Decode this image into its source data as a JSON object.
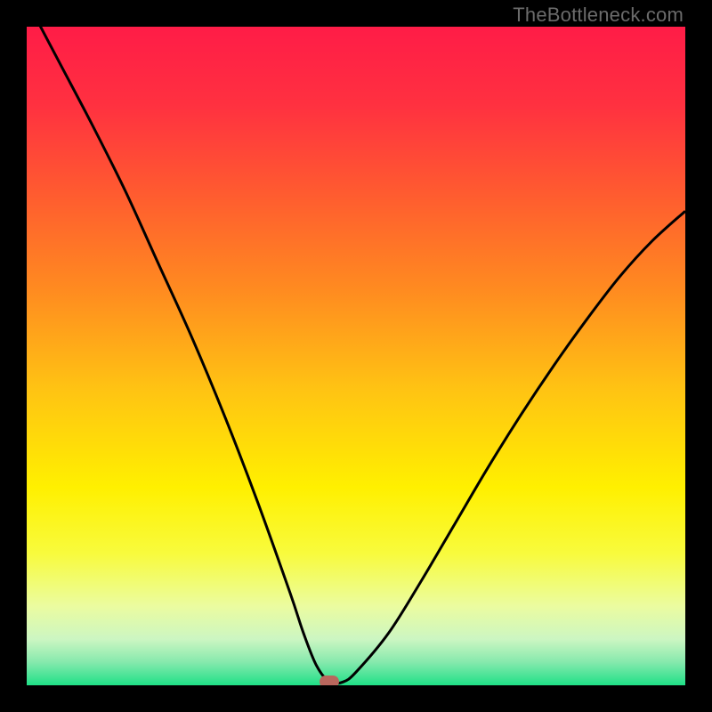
{
  "watermark": "TheBottleneck.com",
  "chart_data": {
    "type": "line",
    "title": "",
    "xlabel": "",
    "ylabel": "",
    "xlim": [
      0,
      100
    ],
    "ylim": [
      0,
      100
    ],
    "series": [
      {
        "name": "bottleneck-curve",
        "x": [
          0,
          5,
          10,
          15,
          20,
          25,
          30,
          35,
          40,
          42,
          44,
          46,
          48,
          50,
          55,
          60,
          65,
          70,
          75,
          80,
          85,
          90,
          95,
          100
        ],
        "y": [
          104,
          94.5,
          85,
          75,
          64,
          53,
          41,
          28,
          14,
          8,
          3,
          0.5,
          0.5,
          2,
          8,
          16,
          24.5,
          33,
          41,
          48.5,
          55.5,
          62,
          67.5,
          72
        ]
      }
    ],
    "marker": {
      "x": 46,
      "y": 0.5,
      "color": "#b9675d"
    },
    "gradient_stops": [
      {
        "pos": 0.0,
        "color": "#ff1c47"
      },
      {
        "pos": 0.12,
        "color": "#ff3140"
      },
      {
        "pos": 0.25,
        "color": "#ff5a30"
      },
      {
        "pos": 0.4,
        "color": "#ff8b20"
      },
      {
        "pos": 0.55,
        "color": "#ffc313"
      },
      {
        "pos": 0.7,
        "color": "#fff000"
      },
      {
        "pos": 0.8,
        "color": "#f8fb3d"
      },
      {
        "pos": 0.88,
        "color": "#ebfca0"
      },
      {
        "pos": 0.93,
        "color": "#ccf6c2"
      },
      {
        "pos": 0.965,
        "color": "#86e9ad"
      },
      {
        "pos": 1.0,
        "color": "#1fe087"
      }
    ]
  }
}
